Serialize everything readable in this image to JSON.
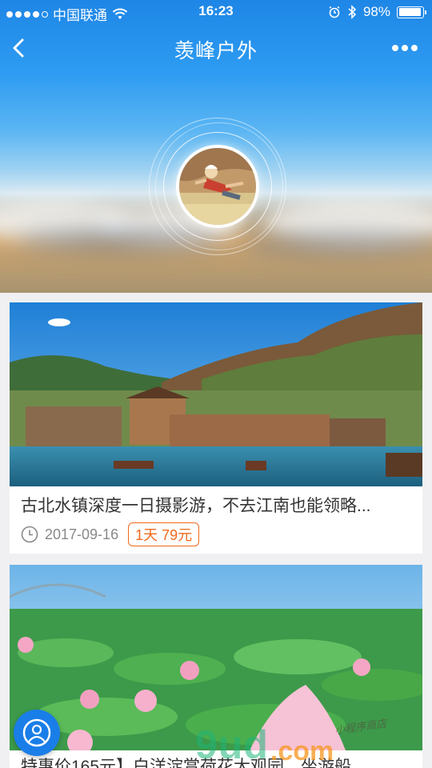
{
  "status_bar": {
    "carrier": "中国联通",
    "time": "16:23",
    "battery": "98%"
  },
  "nav": {
    "title": "羡峰户外"
  },
  "cards": [
    {
      "title": "古北水镇深度一日摄影游，不去江南也能领略...",
      "date": "2017-09-16",
      "price_tag": "1天  79元"
    },
    {
      "title": "特惠价165元】白洋淀赏荷花大观园、坐游船"
    }
  ],
  "watermark": {
    "main": "9ud",
    "com": ".com",
    "script": "小程序商店"
  },
  "colors": {
    "accent": "#1a7ee8",
    "price": "#f06a1b"
  }
}
